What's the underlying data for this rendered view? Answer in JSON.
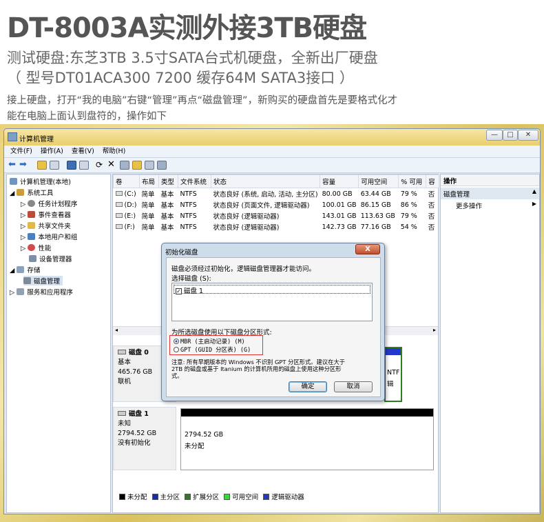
{
  "header": {
    "title": "DT-8003A实测外接3TB硬盘",
    "subtitle_line1": "测试硬盘:东芝3TB 3.5寸SATA台式机硬盘，全新出厂硬盘",
    "subtitle_line2": "（ 型号DT01ACA300 7200 缓存64M SATA3接口 ）",
    "para_line1": "接上硬盘，打开“我的电脑”右键“管理”再点“磁盘管理”，新购买的硬盘首先是要格式化才",
    "para_line2": "能在电脑上面认到盘符的，操作如下"
  },
  "window": {
    "title": "计算机管理",
    "menu": [
      "文件(F)",
      "操作(A)",
      "查看(V)",
      "帮助(H)"
    ],
    "controls": {
      "minimize": "—",
      "maximize": "□",
      "close": "✕"
    }
  },
  "tree": [
    {
      "label": "计算机管理(本地)",
      "level": 0
    },
    {
      "label": "系统工具",
      "level": 1
    },
    {
      "label": "任务计划程序",
      "level": 2
    },
    {
      "label": "事件查看器",
      "level": 2
    },
    {
      "label": "共享文件夹",
      "level": 2
    },
    {
      "label": "本地用户和组",
      "level": 2
    },
    {
      "label": "性能",
      "level": 2
    },
    {
      "label": "设备管理器",
      "level": 2
    },
    {
      "label": "存储",
      "level": 1
    },
    {
      "label": "磁盘管理",
      "level": 2
    },
    {
      "label": "服务和应用程序",
      "level": 1
    }
  ],
  "volume_table": {
    "headers": [
      "卷",
      "布局",
      "类型",
      "文件系统",
      "状态",
      "容量",
      "可用空间",
      "% 可用",
      "容"
    ],
    "rows": [
      [
        "(C:)",
        "简单",
        "基本",
        "NTFS",
        "状态良好 (系统, 启动, 活动, 主分区)",
        "80.00 GB",
        "63.44 GB",
        "79 %",
        "否"
      ],
      [
        "(D:)",
        "简单",
        "基本",
        "NTFS",
        "状态良好 (页面文件, 逻辑驱动器)",
        "100.01 GB",
        "86.15 GB",
        "86 %",
        "否"
      ],
      [
        "(E:)",
        "简单",
        "基本",
        "NTFS",
        "状态良好 (逻辑驱动器)",
        "143.01 GB",
        "113.63 GB",
        "79 %",
        "否"
      ],
      [
        "(F:)",
        "简单",
        "基本",
        "NTFS",
        "状态良好 (逻辑驱动器)",
        "142.73 GB",
        "77.16 GB",
        "54 %",
        "否"
      ]
    ]
  },
  "disks": [
    {
      "name": "磁盘 0",
      "type": "基本",
      "size": "465.76 GB",
      "status": "联机"
    },
    {
      "name": "磁盘 1",
      "type": "未知",
      "size": "2794.52 GB",
      "status": "没有初始化",
      "unalloc_size": "2794.52 GB",
      "unalloc_label": "未分配"
    }
  ],
  "partial_labels": {
    "ntfs": "NTF",
    "logic": "辑"
  },
  "legend": [
    "未分配",
    "主分区",
    "扩展分区",
    "可用空间",
    "逻辑驱动器"
  ],
  "legend_colors": [
    "#000000",
    "#1a2aa8",
    "#2e7d1e",
    "#33dd33",
    "#2338c8"
  ],
  "actions": {
    "header": "操作",
    "section": "磁盘管理",
    "more": "更多操作"
  },
  "dialog": {
    "title": "初始化磁盘",
    "close": "X",
    "intro": "磁盘必须经过初始化，逻辑磁盘管理器才能访问。",
    "select_label": "选择磁盘 (S):",
    "disk_item": "磁盘 1",
    "partition_label": "为所选磁盘使用以下磁盘分区形式:",
    "option_mbr": "MBR (主启动记录) (M)",
    "option_gpt": "GPT (GUID 分区表) (G)",
    "note_line1": "注意: 所有早期版本的 Windows 不识别 GPT 分区形式。建议在大于",
    "note_line2": "2TB 的磁盘或基于 Itanium 的计算机所用的磁盘上使用这种分区形",
    "note_line3": "式。",
    "ok": "确定",
    "cancel": "取消"
  }
}
